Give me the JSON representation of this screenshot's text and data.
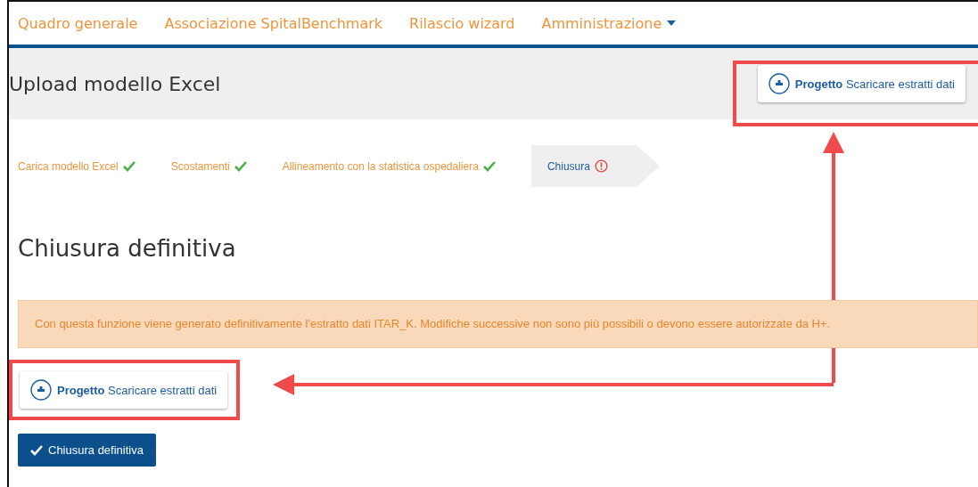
{
  "nav": {
    "items": [
      {
        "label": "Quadro generale",
        "dropdown": false
      },
      {
        "label": "Associazione SpitalBenchmark",
        "dropdown": false
      },
      {
        "label": "Rilascio wizard",
        "dropdown": false
      },
      {
        "label": "Amministrazione",
        "dropdown": true
      }
    ]
  },
  "header": {
    "title": "Upload modello Excel",
    "button": {
      "bold": "Progetto",
      "label": "Scaricare estratti dati"
    }
  },
  "steps": [
    {
      "label": "Carica modello Excel",
      "kind": "done",
      "selected": false
    },
    {
      "label": "Scostamenti",
      "kind": "done",
      "selected": false
    },
    {
      "label": "Allineamento con la statistica ospedaliera",
      "kind": "done",
      "selected": false
    },
    {
      "label": "Chiusura",
      "kind": "error",
      "selected": true
    }
  ],
  "heading": "Chiusura definitiva",
  "alert": "Con questa funzione viene generato definitivamente l'estratto dati ITAR_K. Modifiche successive non sono più possibili o devono essere autorizzate da H+.",
  "download_button": {
    "bold": "Progetto",
    "label": "Scaricare estratti dati"
  },
  "primary_button": "Chiusura definitiva"
}
